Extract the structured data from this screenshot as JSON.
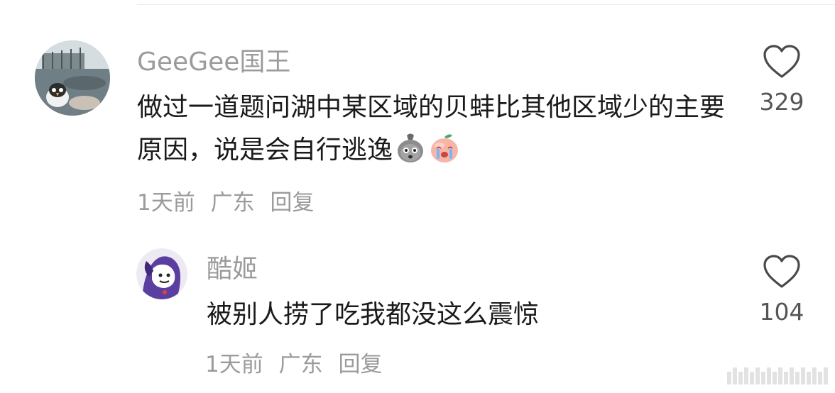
{
  "comments": [
    {
      "username": "GeeGee国王",
      "text": "做过一道题问湖中某区域的贝蚌比其他区域少的主要原因，说是会自行逃逸",
      "emojis": [
        "bag-face-emoji",
        "crying-peach-emoji"
      ],
      "time": "1天前",
      "location": "广东",
      "reply_label": "回复",
      "likes": "329"
    },
    {
      "username": "酷姬",
      "text": "被别人捞了吃我都没这么震惊",
      "time": "1天前",
      "location": "广东",
      "reply_label": "回复",
      "likes": "104"
    }
  ],
  "colors": {
    "meta_gray": "#9b9b9b",
    "text": "#1a1a1a",
    "background": "#ffffff"
  }
}
